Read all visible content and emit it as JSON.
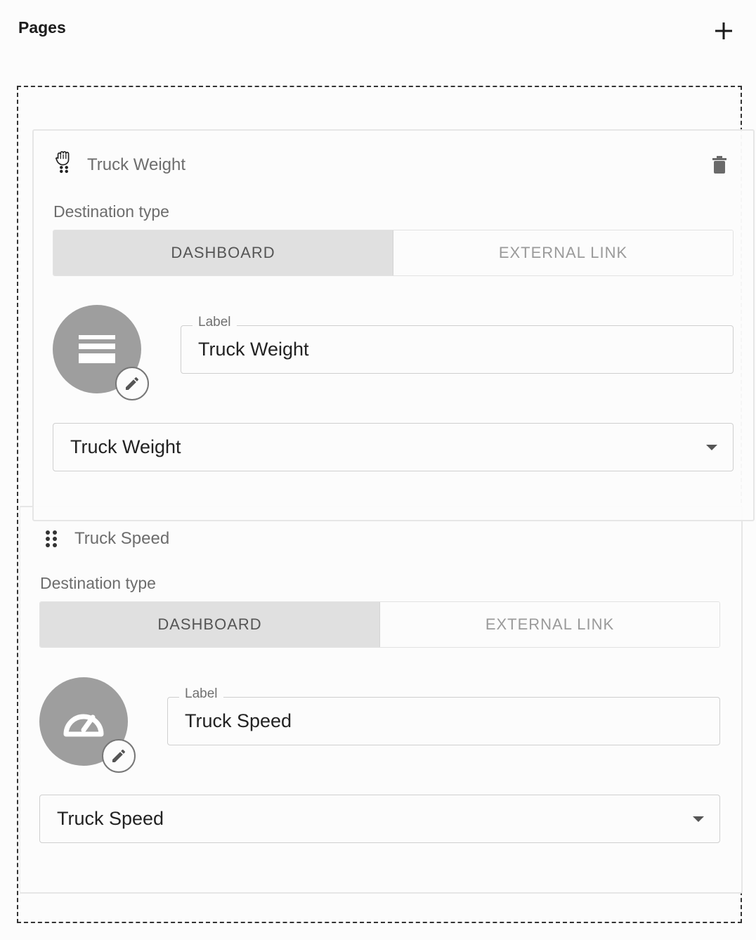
{
  "header": {
    "title": "Pages",
    "add_icon": "plus-icon"
  },
  "pages": [
    {
      "title": "Truck Weight",
      "destination_label": "Destination type",
      "options": [
        "DASHBOARD",
        "EXTERNAL LINK"
      ],
      "selected_option": "DASHBOARD",
      "icon": "view-agenda-icon",
      "label_caption": "Label",
      "label_value": "Truck Weight",
      "dashboard_value": "Truck Weight",
      "drag_state": "grabbing"
    },
    {
      "title": "Truck Speed",
      "destination_label": "Destination type",
      "options": [
        "DASHBOARD",
        "EXTERNAL LINK"
      ],
      "selected_option": "DASHBOARD",
      "icon": "speedometer-icon",
      "label_caption": "Label",
      "label_value": "Truck Speed",
      "dashboard_value": "Truck Speed"
    }
  ],
  "colors": {
    "avatar": "#9e9e9e",
    "active_toggle": "#e0e0e0",
    "dashed_border": "#333333"
  }
}
